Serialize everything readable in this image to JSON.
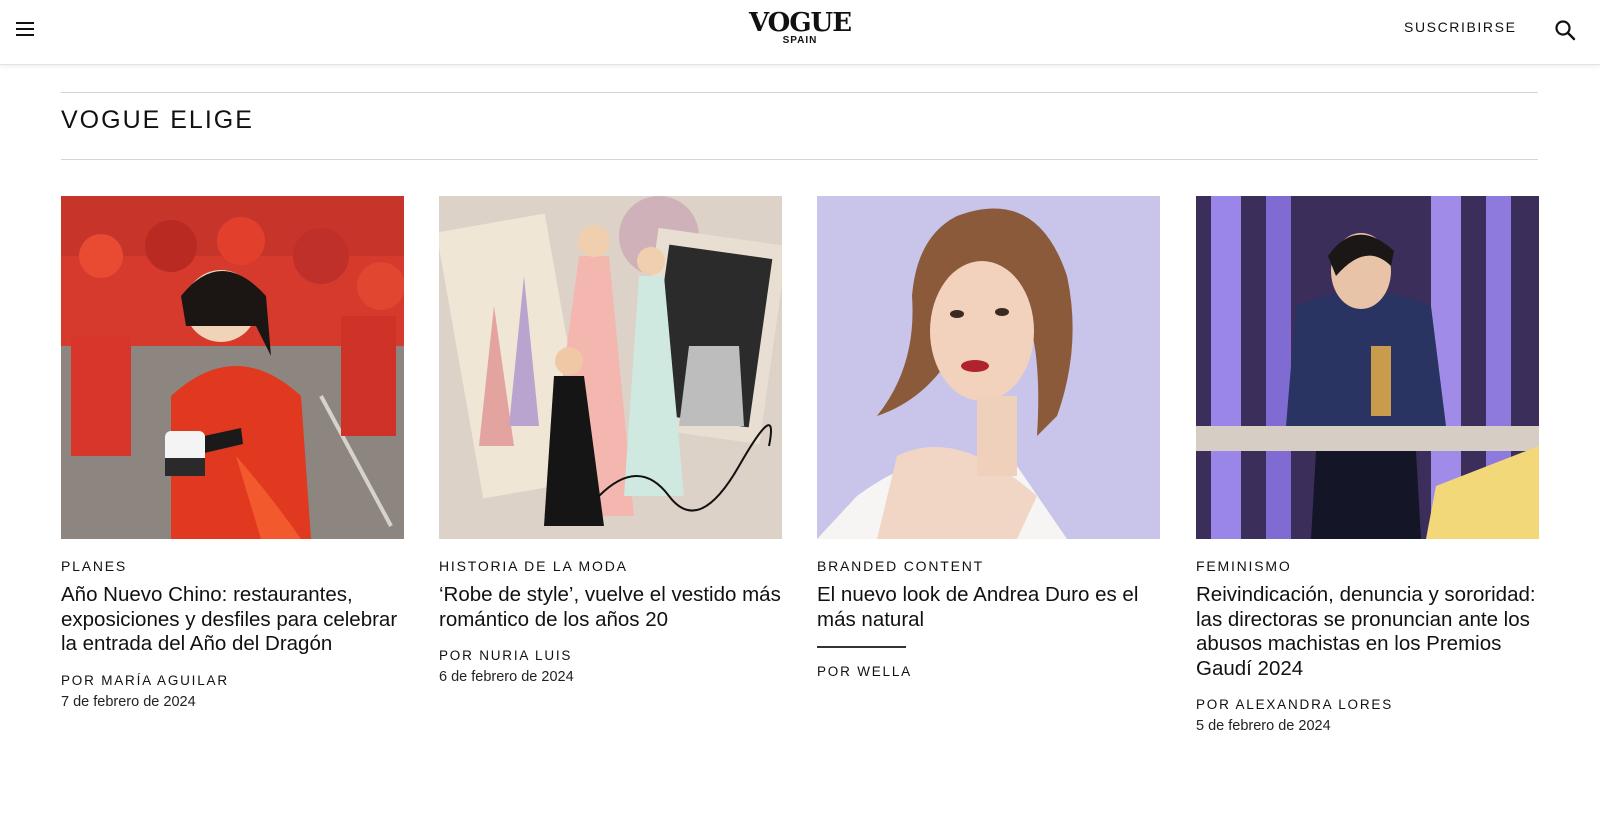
{
  "header": {
    "logo_main": "VOGUE",
    "logo_sub": "SPAIN",
    "subscribe_label": "SUSCRIBIRSE",
    "menu_icon": "hamburger-icon",
    "search_icon": "search-icon"
  },
  "section": {
    "title": "VOGUE ELIGE"
  },
  "cards": [
    {
      "category": "PLANES",
      "headline": "Año Nuevo Chino: restaurantes, exposiciones y desfiles para celebrar la entrada del Año del Dragón",
      "byline": "POR MARÍA AGUILAR",
      "date": "7 de febrero de 2024"
    },
    {
      "category": "HISTORIA DE LA MODA",
      "headline": "‘Robe de style’, vuelve el vestido más romántico de los años 20",
      "byline": "POR NURIA LUIS",
      "date": "6 de febrero de 2024"
    },
    {
      "category": "BRANDED CONTENT",
      "headline": "El nuevo look de Andrea Duro es el más natural",
      "byline": "POR WELLA",
      "date": ""
    },
    {
      "category": "FEMINISMO",
      "headline": "Reivindicación, denuncia y sororidad: las directoras se pronuncian ante los abusos machistas en los Premios Gaudí 2024",
      "byline": "POR ALEXANDRA LORES",
      "date": "5 de febrero de 2024"
    }
  ]
}
